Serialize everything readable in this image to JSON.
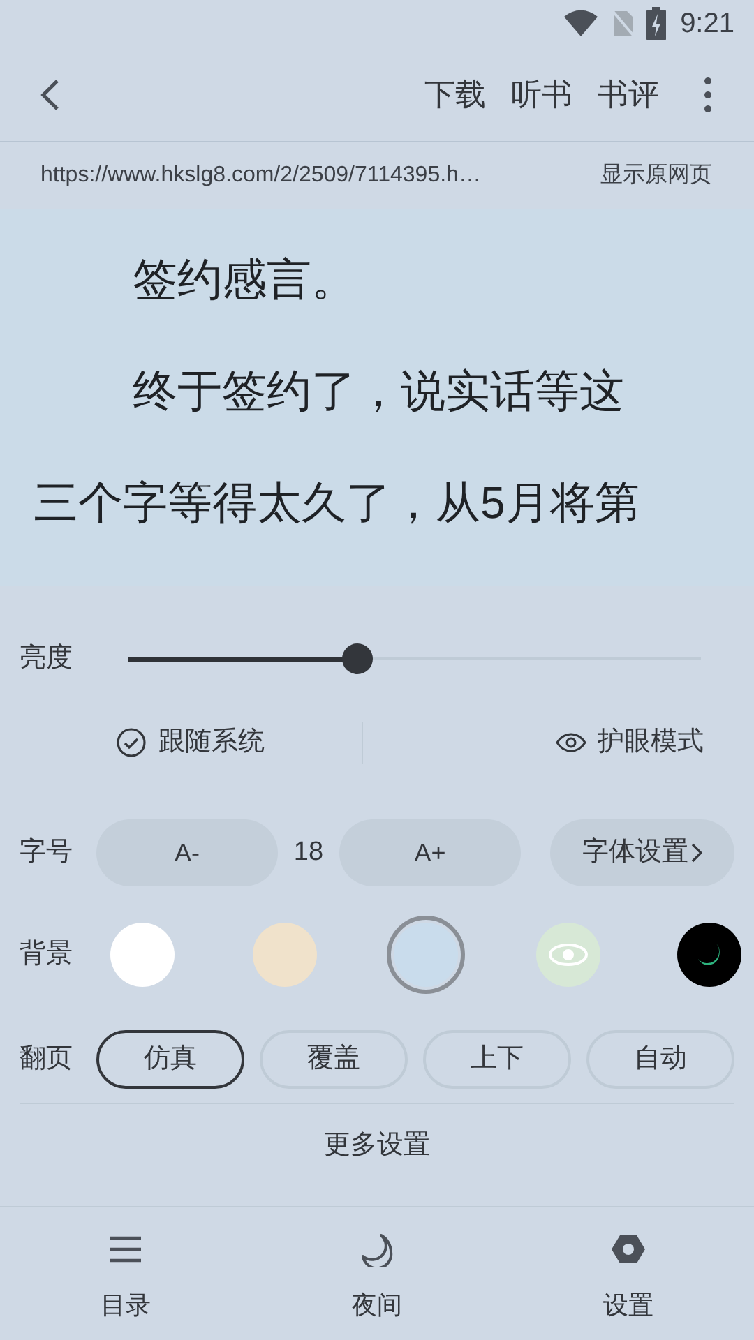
{
  "status_bar": {
    "time": "9:21"
  },
  "toolbar": {
    "actions": [
      "下载",
      "听书",
      "书评"
    ]
  },
  "url_bar": {
    "url": "https://www.hkslg8.com/2/2509/7114395.h…",
    "button": "显示原网页"
  },
  "content": {
    "paragraphs": [
      {
        "lines": [
          "签约感言。"
        ]
      },
      {
        "lines": [
          "终于签约了，说实话等这",
          "三个字等得太久了，从5月将第"
        ]
      }
    ]
  },
  "settings": {
    "brightness": {
      "label": "亮度",
      "level": 0.4
    },
    "follow_system": {
      "label": "跟随系统",
      "checked": true
    },
    "eye_care": {
      "label": "护眼模式"
    },
    "font_size": {
      "label": "字号",
      "decrease": "A-",
      "value": "18",
      "increase": "A+",
      "font_settings": "字体设置"
    },
    "background": {
      "label": "背景",
      "swatches": [
        {
          "color": "#ffffff",
          "kind": "plain",
          "selected": false
        },
        {
          "color": "#f0e2cb",
          "kind": "plain",
          "selected": false
        },
        {
          "color": "#c9dcec",
          "kind": "plain",
          "selected": true
        },
        {
          "color": "#d7e8d6",
          "kind": "eye",
          "selected": false
        },
        {
          "color": "#000000",
          "kind": "night",
          "selected": false
        }
      ]
    },
    "page_turn": {
      "label": "翻页",
      "modes": [
        {
          "label": "仿真",
          "selected": true
        },
        {
          "label": "覆盖",
          "selected": false
        },
        {
          "label": "上下",
          "selected": false
        },
        {
          "label": "自动",
          "selected": false
        }
      ]
    },
    "more": "更多设置"
  },
  "bottom_nav": [
    {
      "label": "目录",
      "kind": "menu"
    },
    {
      "label": "夜间",
      "kind": "moon"
    },
    {
      "label": "设置",
      "kind": "gear"
    }
  ]
}
